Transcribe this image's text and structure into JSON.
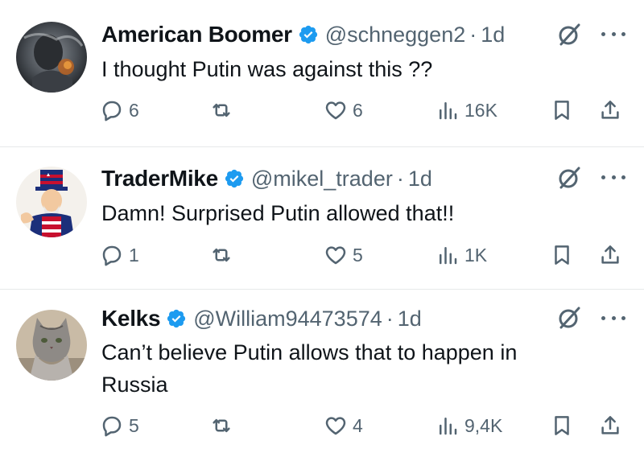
{
  "tweets": [
    {
      "name": "American Boomer",
      "handle": "@schneggen2",
      "separator": "·",
      "time": "1d",
      "text": "I thought Putin was against this ??",
      "avatar": "dark-smoky-illustration-avatar",
      "stats": {
        "replies": "6",
        "likes": "6",
        "views": "16K"
      }
    },
    {
      "name": "TraderMike",
      "handle": "@mikel_trader",
      "separator": "·",
      "time": "1d",
      "text": "Damn! Surprised Putin allowed that!!",
      "avatar": "uncle-sam-cartoon-avatar",
      "stats": {
        "replies": "1",
        "likes": "5",
        "views": "1K"
      }
    },
    {
      "name": "Kelks",
      "handle": "@William94473574",
      "separator": "·",
      "time": "1d",
      "text": "Can’t believe Putin allows that to happen in Russia",
      "avatar": "gray-cat-photo-avatar",
      "stats": {
        "replies": "5",
        "likes": "4",
        "views": "9,4K"
      }
    }
  ],
  "colors": {
    "verified": "#1d9bf0",
    "secondary_text": "#536471",
    "primary_text": "#0f1419",
    "divider": "#e6e9ea"
  },
  "icons": [
    "verified-badge-icon",
    "grok-icon",
    "more-icon",
    "reply-icon",
    "retweet-icon",
    "like-icon",
    "views-icon",
    "bookmark-icon",
    "share-icon"
  ]
}
